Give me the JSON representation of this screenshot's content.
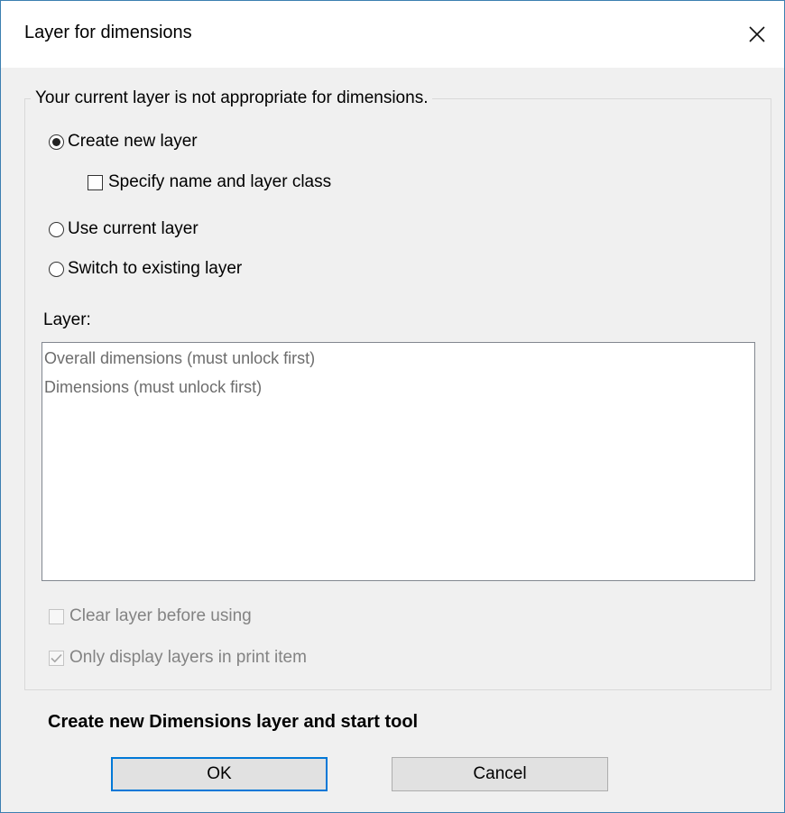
{
  "dialog": {
    "title": "Layer for dimensions",
    "close_icon": "close-icon"
  },
  "group": {
    "legend": "Your current layer is not appropriate for dimensions.",
    "options": {
      "create_new": {
        "label": "Create new layer",
        "selected": true
      },
      "specify_name": {
        "label": "Specify name and layer class",
        "checked": false
      },
      "use_current": {
        "label": "Use current layer",
        "selected": false
      },
      "switch_existing": {
        "label": "Switch to existing layer",
        "selected": false
      }
    },
    "layer_label": "Layer:",
    "layers": [
      "Overall dimensions (must unlock first)",
      "Dimensions (must unlock first)"
    ],
    "clear_layer": {
      "label": "Clear layer before using",
      "checked": false,
      "disabled": true
    },
    "only_display": {
      "label": "Only display layers in print item",
      "checked": true,
      "disabled": true
    }
  },
  "instruction": "Create new Dimensions layer and start tool",
  "buttons": {
    "ok": "OK",
    "cancel": "Cancel"
  }
}
